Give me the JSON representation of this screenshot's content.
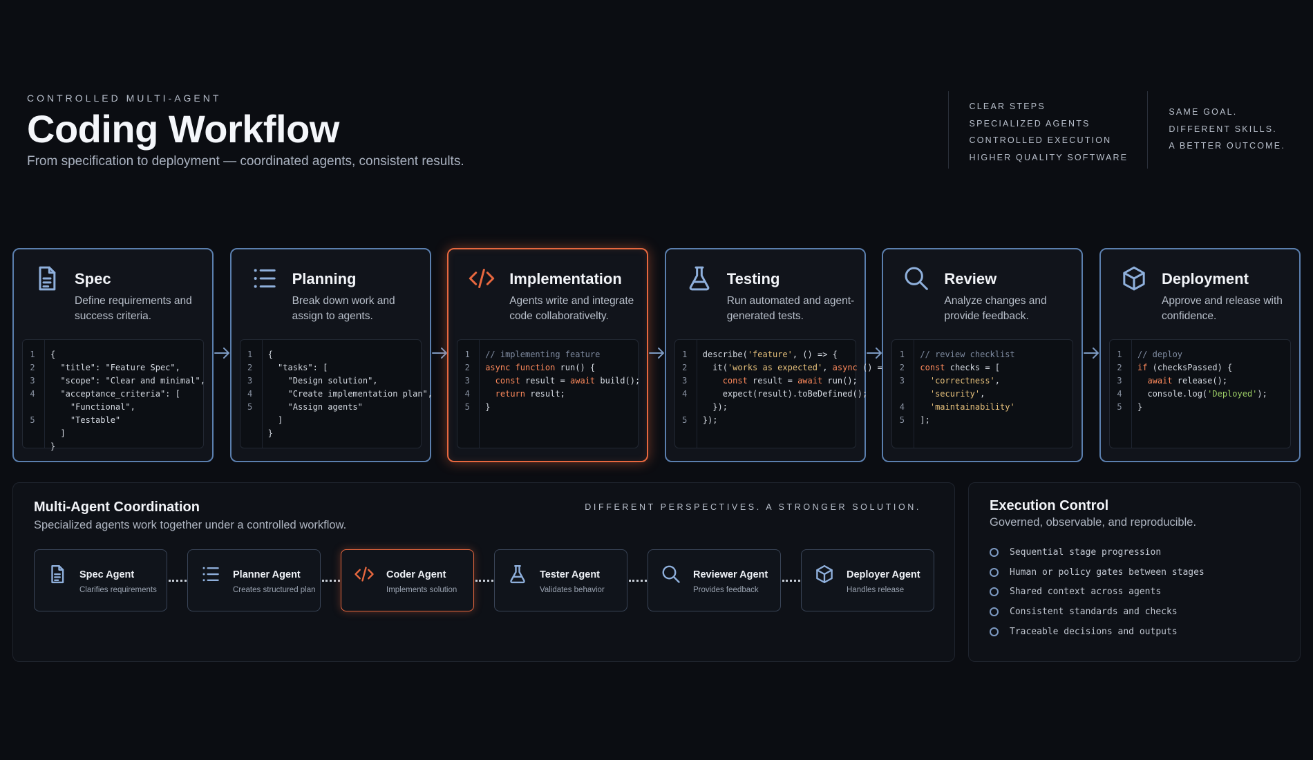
{
  "header": {
    "eyebrow": "CONTROLLED MULTI-AGENT",
    "title": "Coding Workflow",
    "subtitle": "From specification to deployment — coordinated agents, consistent results.",
    "col1": [
      "CLEAR STEPS",
      "SPECIALIZED AGENTS",
      "CONTROLLED EXECUTION",
      "HIGHER QUALITY SOFTWARE"
    ],
    "col2": [
      "SAME GOAL.",
      "DIFFERENT SKILLS.",
      "A BETTER OUTCOME."
    ]
  },
  "stages": [
    {
      "title": "Spec",
      "icon": "document-icon",
      "desc": "Define requirements and success criteria.",
      "code": [
        {
          "ln": "1",
          "text": "{"
        },
        {
          "ln": "2",
          "text": "  \"title\": \"Feature Spec\","
        },
        {
          "ln": "3",
          "text": "  \"scope\": \"Clear and minimal\","
        },
        {
          "ln": "4",
          "text": "  \"acceptance_criteria\": ["
        },
        {
          "ln": "",
          "text": "    \"Functional\","
        },
        {
          "ln": "5",
          "text": "    \"Testable\""
        },
        {
          "ln": "",
          "text": "  ]"
        },
        {
          "ln": "",
          "text": "}"
        }
      ]
    },
    {
      "title": "Planning",
      "icon": "list-icon",
      "desc": "Break down work and assign to agents.",
      "code": [
        {
          "ln": "1",
          "text": "{"
        },
        {
          "ln": "2",
          "text": "  \"tasks\": ["
        },
        {
          "ln": "3",
          "text": "    \"Design solution\","
        },
        {
          "ln": "4",
          "text": "    \"Create implementation plan\","
        },
        {
          "ln": "5",
          "text": "    \"Assign agents\""
        },
        {
          "ln": "",
          "text": "  ]"
        },
        {
          "ln": "",
          "text": "}"
        }
      ]
    },
    {
      "title": "Implementation",
      "icon": "code-icon",
      "desc": "Agents write and integrate code collaborativelty.",
      "code": [
        {
          "ln": "1",
          "text": "// implementing feature"
        },
        {
          "ln": "2",
          "text": "async function run() {"
        },
        {
          "ln": "3",
          "text": "  const result = await build();"
        },
        {
          "ln": "4",
          "text": "  return result;"
        },
        {
          "ln": "5",
          "text": "}"
        }
      ]
    },
    {
      "title": "Testing",
      "icon": "flask-icon",
      "desc": "Run automated and agent-generated tests.",
      "code": [
        {
          "ln": "1",
          "text": "describe('feature', () => {"
        },
        {
          "ln": "2",
          "text": "  it('works as expected', async () =>"
        },
        {
          "ln": "3",
          "text": "    const result = await run();"
        },
        {
          "ln": "4",
          "text": "    expect(result).toBeDefined();"
        },
        {
          "ln": "",
          "text": "  });"
        },
        {
          "ln": "5",
          "text": "});"
        }
      ]
    },
    {
      "title": "Review",
      "icon": "magnifier-icon",
      "desc": "Analyze changes and provide feedback.",
      "code": [
        {
          "ln": "1",
          "text": "// review checklist"
        },
        {
          "ln": "2",
          "text": "const checks = ["
        },
        {
          "ln": "3",
          "text": "  'correctness',"
        },
        {
          "ln": "",
          "text": "  'security',"
        },
        {
          "ln": "4",
          "text": "  'maintainability'"
        },
        {
          "ln": "5",
          "text": "];"
        }
      ]
    },
    {
      "title": "Deployment",
      "icon": "cube-icon",
      "desc": "Approve and release with confidence.",
      "code": [
        {
          "ln": "1",
          "text": "// deploy"
        },
        {
          "ln": "2",
          "text": "if (checksPassed) {"
        },
        {
          "ln": "3",
          "text": "  await release();"
        },
        {
          "ln": "4",
          "text": "  console.log('Deployed');"
        },
        {
          "ln": "5",
          "text": "}"
        }
      ]
    }
  ],
  "coordination": {
    "title": "Multi-Agent Coordination",
    "subtitle": "Specialized agents work together under a controlled workflow.",
    "tagline": "DIFFERENT PERSPECTIVES. A STRONGER SOLUTION.",
    "agents": [
      {
        "name": "Spec Agent",
        "role": "Clarifies requirements",
        "icon": "document-icon"
      },
      {
        "name": "Planner Agent",
        "role": "Creates structured plan",
        "icon": "list-icon"
      },
      {
        "name": "Coder Agent",
        "role": "Implements solution",
        "icon": "code-icon"
      },
      {
        "name": "Tester Agent",
        "role": "Validates behavior",
        "icon": "flask-icon"
      },
      {
        "name": "Reviewer Agent",
        "role": "Provides feedback",
        "icon": "magnifier-icon"
      },
      {
        "name": "Deployer Agent",
        "role": "Handles release",
        "icon": "cube-icon"
      }
    ]
  },
  "execution": {
    "title": "Execution Control",
    "subtitle": "Governed, observable, and reproducible.",
    "items": [
      "Sequential stage progression",
      "Human or policy gates between stages",
      "Shared context across agents",
      "Consistent standards and checks",
      "Traceable decisions and outputs"
    ]
  },
  "colors": {
    "background": "#0b0d12",
    "stage_border": "#5b7fae",
    "active_accent": "#e8683f",
    "icon_blue": "#8fb0dc"
  },
  "active_stage": 2
}
